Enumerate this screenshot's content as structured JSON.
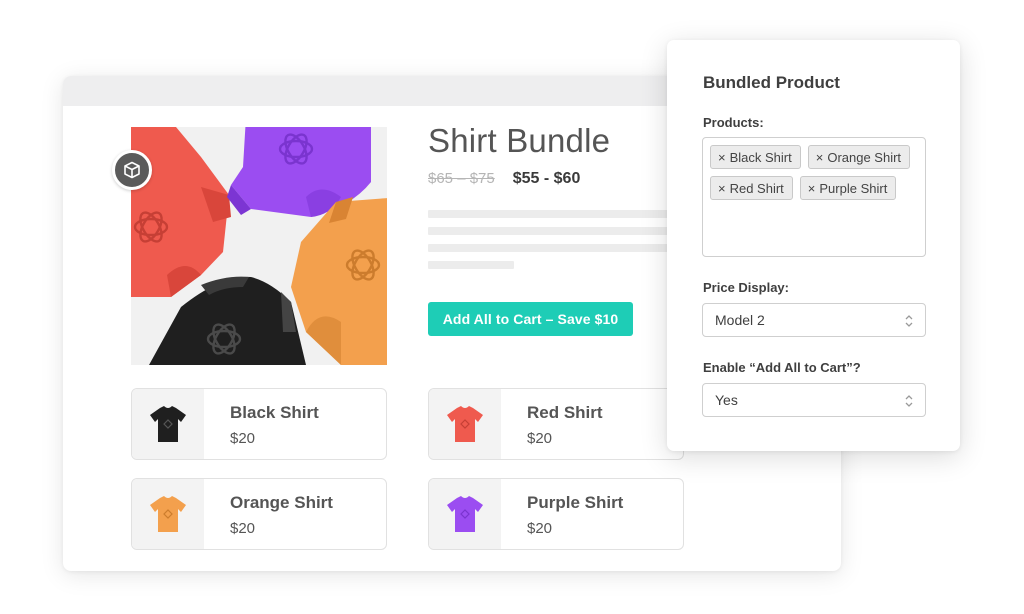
{
  "product": {
    "title": "Shirt Bundle",
    "price_old": "$65 – $75",
    "price_new": "$55 - $60",
    "add_all_label": "Add All to Cart – Save $10",
    "items": [
      {
        "name": "Black Shirt",
        "price": "$20",
        "color": "#1f1f1f"
      },
      {
        "name": "Red Shirt",
        "price": "$20",
        "color": "#ef5a4e"
      },
      {
        "name": "Orange Shirt",
        "price": "$20",
        "color": "#f3a04d"
      },
      {
        "name": "Purple Shirt",
        "price": "$20",
        "color": "#9b4df1"
      }
    ]
  },
  "panel": {
    "title": "Bundled Product",
    "products_label": "Products:",
    "products": [
      "Black Shirt",
      "Orange Shirt",
      "Red Shirt",
      "Purple Shirt"
    ],
    "tag_remove_symbol": "×",
    "price_display_label": "Price Display:",
    "price_display_value": "Model 2",
    "enable_label": "Enable “Add All to Cart”?",
    "enable_value": "Yes"
  },
  "colors": {
    "accent": "#1ecdb6",
    "shirt_black": "#1f1f1f",
    "shirt_red": "#ef5a4e",
    "shirt_orange": "#f3a04d",
    "shirt_purple": "#9b4df1"
  },
  "icons": {
    "badge": "box-icon",
    "tag_remove": "close-icon",
    "select": "updown-chevron-icon",
    "logo": "atom-logo-icon"
  }
}
